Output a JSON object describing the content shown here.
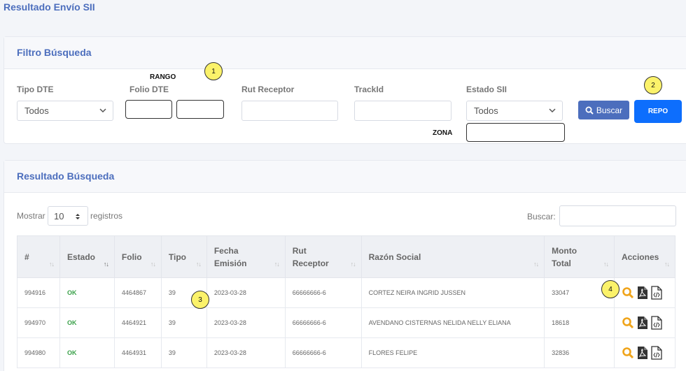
{
  "page": {
    "title": "Resultado Envío SII"
  },
  "filter": {
    "title": "Filtro Búsqueda",
    "tipo_dte": {
      "label": "Tipo DTE",
      "value": "Todos"
    },
    "rango_label": "RANGO",
    "folio_label": "Folio DTE",
    "rut_label": "Rut Receptor",
    "trackid_label": "TrackId",
    "estado_sii": {
      "label": "Estado SII",
      "value": "Todos"
    },
    "zona_label": "ZONA",
    "buscar_label": "Buscar",
    "repo_label": "REPO"
  },
  "annotations": {
    "b1": "1",
    "b2": "2",
    "b3": "3",
    "b4": "4"
  },
  "results": {
    "title": "Resultado Búsqueda",
    "show_label": "Mostrar",
    "page_size": "10",
    "records_label": "registros",
    "search_label": "Buscar:",
    "columns": [
      "#",
      "Estado",
      "Folio",
      "Tipo",
      "Fecha\nEmisión",
      "Rut\nReceptor",
      "Razón Social",
      "Monto\nTotal",
      "Acciones"
    ],
    "rows": [
      {
        "id": "994916",
        "estado": "OK",
        "folio": "4464867",
        "tipo": "39",
        "fecha": "2023-03-28",
        "rut": "66666666-6",
        "razon": "CORTEZ NEIRA INGRID JUSSEN",
        "monto": "33047"
      },
      {
        "id": "994970",
        "estado": "OK",
        "folio": "4464921",
        "tipo": "39",
        "fecha": "2023-03-28",
        "rut": "66666666-6",
        "razon": "AVENDANO CISTERNAS NELIDA NELLY ELIANA",
        "monto": "18618"
      },
      {
        "id": "994980",
        "estado": "OK",
        "folio": "4464931",
        "tipo": "39",
        "fecha": "2023-03-28",
        "rut": "66666666-6",
        "razon": "FLORES FELIPE",
        "monto": "32836"
      }
    ]
  },
  "icons": {
    "search": "search-icon",
    "view": "magnifier-icon",
    "pdf": "pdf-icon",
    "xml": "xml-file-icon",
    "chevron": "chevron-down-icon"
  }
}
